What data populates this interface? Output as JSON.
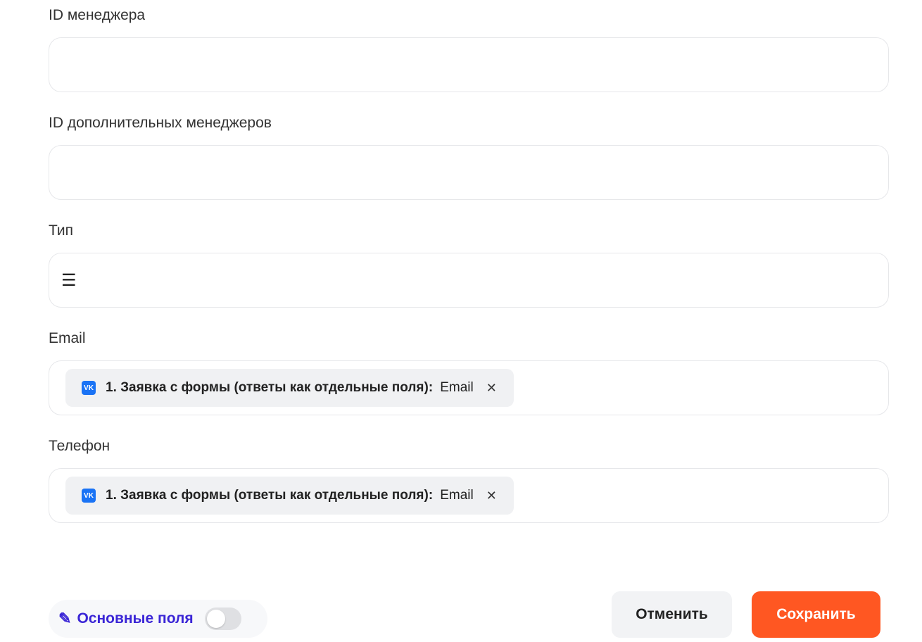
{
  "fields": [
    {
      "label": "ID менеджера",
      "value": ""
    },
    {
      "label": "ID дополнительных менеджеров",
      "value": ""
    },
    {
      "label": "Тип",
      "icon": "list-icon"
    },
    {
      "label": "Email",
      "chip": {
        "source": "1. Заявка с формы (ответы как отдельные поля):",
        "field": "Email",
        "icon_text": "VK"
      }
    },
    {
      "label": "Телефон",
      "chip": {
        "source": "1. Заявка с формы (ответы как отдельные поля):",
        "field": "Email",
        "icon_text": "VK"
      }
    }
  ],
  "footer": {
    "main_fields_label": "Основные поля",
    "main_fields_on": false,
    "cancel": "Отменить",
    "save": "Сохранить"
  },
  "colors": {
    "accent": "#ff5722",
    "toggle_text": "#3a25d6"
  }
}
